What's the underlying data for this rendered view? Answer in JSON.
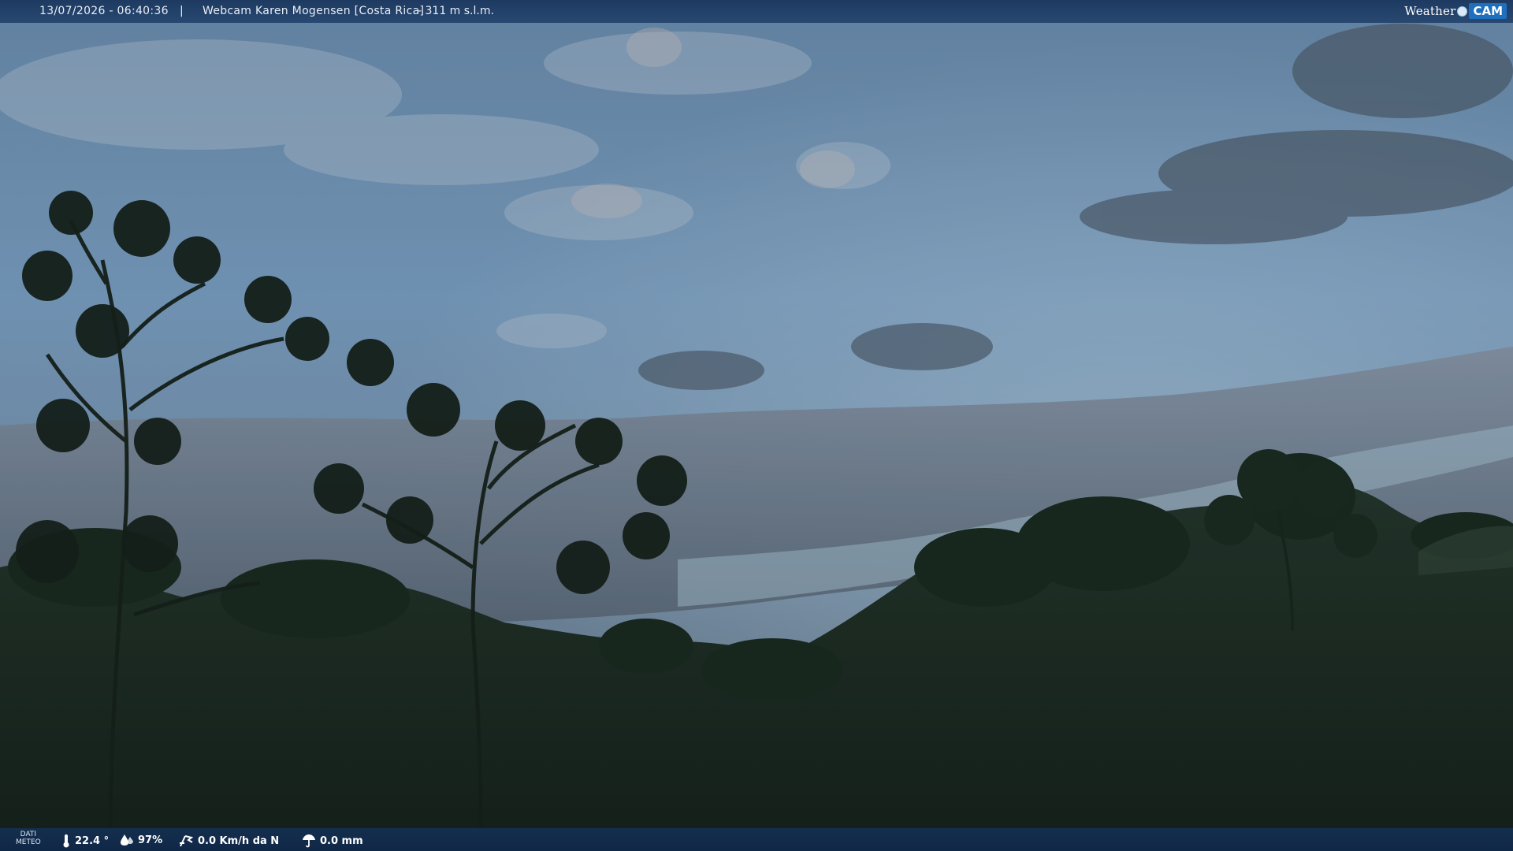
{
  "header": {
    "timestamp": "13/07/2026 - 06:40:36",
    "separator": "|",
    "camera_title": "Webcam Karen Mogensen [Costa Rica]",
    "altitude": "- 311 m s.l.m.",
    "logo_left": "Weather",
    "logo_right": "CAM"
  },
  "footer": {
    "label_line1": "DATI",
    "label_line2": "METEO",
    "temperature": "22.4 °",
    "humidity": "97%",
    "wind": "0.0 Km/h da N",
    "rain": "0.0 mm"
  },
  "icons": {
    "temperature": "thermometer-icon",
    "humidity": "humidity-drop-icon",
    "wind": "wind-icon",
    "rain": "rain-umbrella-icon",
    "logo": "weathercam-logo-icon"
  },
  "colors": {
    "bar_blue": "#1e3e69",
    "sky_top": "#6f93b8",
    "sky_mid": "#7fa3c6",
    "cloud_gray": "#6c7a8c",
    "forest_dark": "#1b2a1f"
  }
}
